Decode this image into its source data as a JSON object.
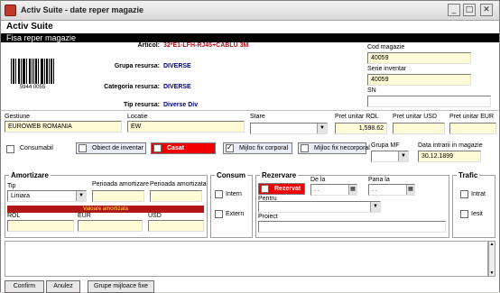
{
  "window": {
    "title": "Activ Suite - date reper magazie",
    "minimize": "_",
    "maximize": "□",
    "close": "✕"
  },
  "app_title": "Activ Suite",
  "section_title": "Fisa reper magazie",
  "barcode_number": "5944 0055",
  "info": {
    "articol_label": "Articol:",
    "articol_value": "32*E1-LFH-RJ45+CABLU 3M",
    "grupa_label": "Grupa resursa:",
    "grupa_value": "DIVERSE",
    "categoria_label": "Categoria resursa:",
    "categoria_value": "DIVERSE",
    "tip_label": "Tip resursa:",
    "tip_value": "Diverse Div"
  },
  "codes": {
    "cod_label": "Cod magazie",
    "cod_value": "40059",
    "serie_label": "Serie inventar",
    "serie_value": "40059",
    "sn_label": "SN",
    "sn_value": ""
  },
  "row1": {
    "gestiune_label": "Gestiune",
    "gestiune_value": "EUROWEB ROMANIA",
    "locatie_label": "Locatie",
    "locatie_value": "EW",
    "stare_label": "Stare",
    "stare_value": "",
    "pret_rol_label": "Pret unitar ROL",
    "pret_rol_value": "1,598.62",
    "pret_usd_label": "Pret unitar USD",
    "pret_usd_value": "",
    "pret_eur_label": "Pret unitar EUR",
    "pret_eur_value": ""
  },
  "flags": {
    "consumabil": "Consumabil",
    "obiect_inventar": "Obiect de inventar",
    "casat": "Casat",
    "mijloc_corporal": "Mijloc fix corporal",
    "mijloc_necorporal": "Mijloc fix necorporal",
    "grupa_mf_label": "Grupa MF",
    "grupa_mf_value": "",
    "data_intrarii_label": "Data intrarii in magazie",
    "data_intrarii_value": "30.12.1899"
  },
  "amortizare": {
    "title": "Amortizare",
    "tip_label": "Tip",
    "tip_value": "Liniara",
    "perioada_label": "Perioada amortizare",
    "perioada_value": "",
    "perioada_am_label": "Perioada amortizata",
    "perioada_am_value": "",
    "valoare_label": "Valoare amortizata",
    "rol_label": "ROL",
    "eur_label": "EUR",
    "usd_label": "USD"
  },
  "consum": {
    "title": "Consum",
    "intern": "Intern",
    "extern": "Extern"
  },
  "rezervare": {
    "title": "Rezervare",
    "rezervat": "Rezervat",
    "de_la_label": "De la",
    "de_la_value": ". .",
    "pana_la_label": "Pana la",
    "pana_la_value": ". .",
    "pentru_label": "Pentru",
    "proiect_label": "Proiect"
  },
  "trafic": {
    "title": "Trafic",
    "intrat": "Intrat",
    "iesit": "Iesit"
  },
  "buttons": {
    "confirm": "Confirm",
    "anulez": "Anulez",
    "grupe": "Grupe mijloace fixe"
  }
}
